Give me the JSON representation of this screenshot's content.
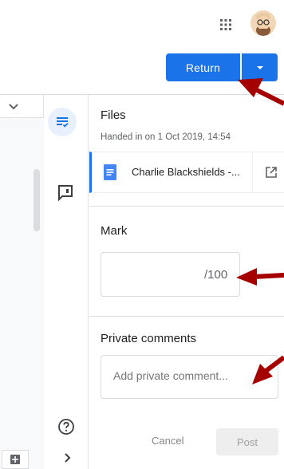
{
  "header": {
    "apps_icon": "apps-grid-icon",
    "avatar_icon": "user-avatar",
    "return_label": "Return",
    "return_dropdown_icon": "caret-down-icon"
  },
  "left_rail": {
    "items": [
      {
        "icon": "student-work-icon",
        "active": true
      },
      {
        "icon": "comment-icon",
        "active": false
      }
    ],
    "help_icon": "help-icon",
    "next_icon": "chevron-right-icon"
  },
  "files": {
    "title": "Files",
    "handed_in": "Handed in on 1 Oct 2019, 14:54",
    "file_name": "Charlie Blackshields -...",
    "file_icon": "google-docs-icon",
    "open_icon": "open-in-new-icon"
  },
  "mark": {
    "title": "Mark",
    "value": "",
    "denominator": "/100"
  },
  "private_comments": {
    "title": "Private comments",
    "placeholder": "Add private comment...",
    "cancel_label": "Cancel",
    "post_label": "Post"
  },
  "colors": {
    "accent": "#1a73e8",
    "arrow": "#a50000"
  }
}
